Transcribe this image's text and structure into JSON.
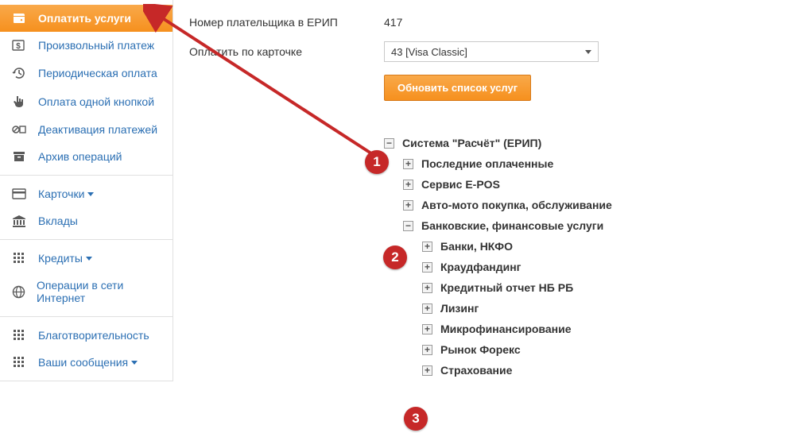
{
  "sidebar": {
    "group1": [
      {
        "label": "Оплатить услуги",
        "icon": "wallet",
        "active": true
      },
      {
        "label": "Произвольный платеж",
        "icon": "dollar"
      },
      {
        "label": "Периодическая оплата",
        "icon": "history"
      },
      {
        "label": "Оплата одной кнопкой",
        "icon": "hand"
      },
      {
        "label": "Деактивация платежей",
        "icon": "deactivate"
      },
      {
        "label": "Архив операций",
        "icon": "archive"
      }
    ],
    "group2": [
      {
        "label": "Карточки",
        "icon": "card",
        "caret": true
      },
      {
        "label": "Вклады",
        "icon": "bank"
      }
    ],
    "group3": [
      {
        "label": "Кредиты",
        "icon": "grid",
        "caret": true
      },
      {
        "label": "Операции в сети Интернет",
        "icon": "globe"
      }
    ],
    "group4": [
      {
        "label": "Благотворительность",
        "icon": "grid"
      },
      {
        "label": "Ваши сообщения",
        "icon": "grid",
        "caret": true
      }
    ]
  },
  "form": {
    "payer_label": "Номер плательщика в ЕРИП",
    "payer_value": "417",
    "card_label": "Оплатить по карточке",
    "card_value": "43                         [Visa Classic]",
    "update_btn": "Обновить список услуг"
  },
  "tree": {
    "root_label": "Система \"Расчёт\" (ЕРИП)",
    "children": [
      {
        "label": "Последние оплаченные"
      },
      {
        "label": "Сервис E-POS"
      },
      {
        "label": "Авто-мото покупка, обслуживание"
      },
      {
        "label": "Банковские, финансовые услуги",
        "children": [
          {
            "label": "Банки, НКФО"
          },
          {
            "label": "Краудфандинг"
          },
          {
            "label": "Кредитный отчет НБ РБ"
          },
          {
            "label": "Лизинг"
          },
          {
            "label": "Микрофинансирование"
          },
          {
            "label": "Рынок Форекс"
          },
          {
            "label": "Страхование"
          }
        ]
      }
    ]
  },
  "callouts": {
    "c1": "1",
    "c2": "2",
    "c3": "3"
  }
}
